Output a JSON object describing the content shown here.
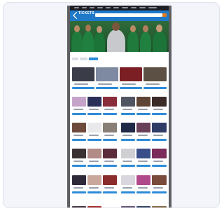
{
  "card": {
    "background": "#f3f5fa"
  },
  "site": {
    "brand_color": "#1f78c8",
    "accent_color": "#e07b1f",
    "logo_text": "TICKETS",
    "logo_sub": ""
  },
  "topnav": {
    "items": [
      "",
      "",
      "",
      "",
      "",
      "",
      "",
      "",
      "",
      ""
    ]
  },
  "search": {
    "placeholder": ""
  },
  "page": {
    "title": ""
  },
  "sections": [
    {
      "title": "",
      "tiles": 4
    },
    {
      "title": "",
      "tiles": 3
    },
    {
      "title": "",
      "tiles": 3
    },
    {
      "title": "",
      "tiles": 3
    },
    {
      "title": "",
      "tiles": 3
    },
    {
      "title": "",
      "tiles": 3
    },
    {
      "title": "",
      "tiles": 3
    },
    {
      "title": "",
      "tiles": 3
    },
    {
      "title": "",
      "tiles": 3
    }
  ]
}
